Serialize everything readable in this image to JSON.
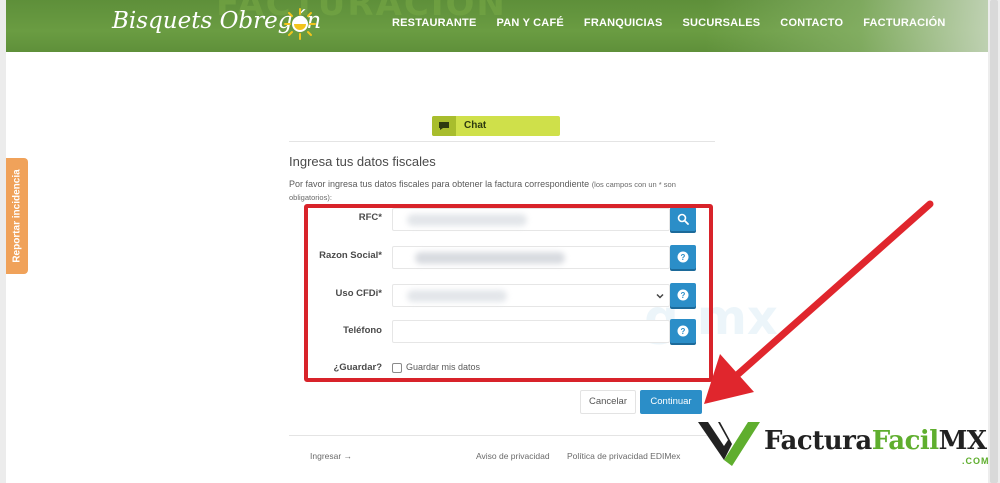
{
  "header": {
    "background_word": "FACTURACION",
    "logo_text": "Bisquets Obregón",
    "nav": [
      "RESTAURANTE",
      "PAN Y CAFÉ",
      "FRANQUICIAS",
      "SUCURSALES",
      "CONTACTO",
      "FACTURACIÓN"
    ]
  },
  "side_tab": {
    "label": "Reportar incidencia"
  },
  "chat": {
    "label": "Chat"
  },
  "form": {
    "title": "Ingresa tus datos fiscales",
    "description": "Por favor ingresa tus datos fiscales para obtener la factura correspondiente",
    "description_note": "(los campos con un * son obligatorios):",
    "fields": {
      "rfc_label": "RFC*",
      "razon_label": "Razon Social*",
      "uso_label": "Uso CFDi*",
      "telefono_label": "Teléfono",
      "guardar_label": "¿Guardar?"
    },
    "checkbox_label": "Guardar mis datos",
    "cancel_label": "Cancelar",
    "continue_label": "Continuar"
  },
  "footer": {
    "login": "Ingresar",
    "privacy": "Aviso de privacidad",
    "edimex": "Política de privacidad EDIMex"
  },
  "watermark": {
    "brand_dark": "Factura",
    "brand_green": "Facil",
    "brand_mx": "MX",
    "domain": ".COM"
  },
  "colors": {
    "header_green": "#6a9c42",
    "highlight_red": "#d8232a",
    "button_blue": "#2b8ec8",
    "chat_yellow": "#cfe04a",
    "report_orange": "#f0a25a"
  },
  "icons": [
    "sun-icon",
    "chat-bubble-icon",
    "search-icon",
    "help-icon",
    "chevron-down-icon",
    "login-icon",
    "arrow-icon"
  ]
}
